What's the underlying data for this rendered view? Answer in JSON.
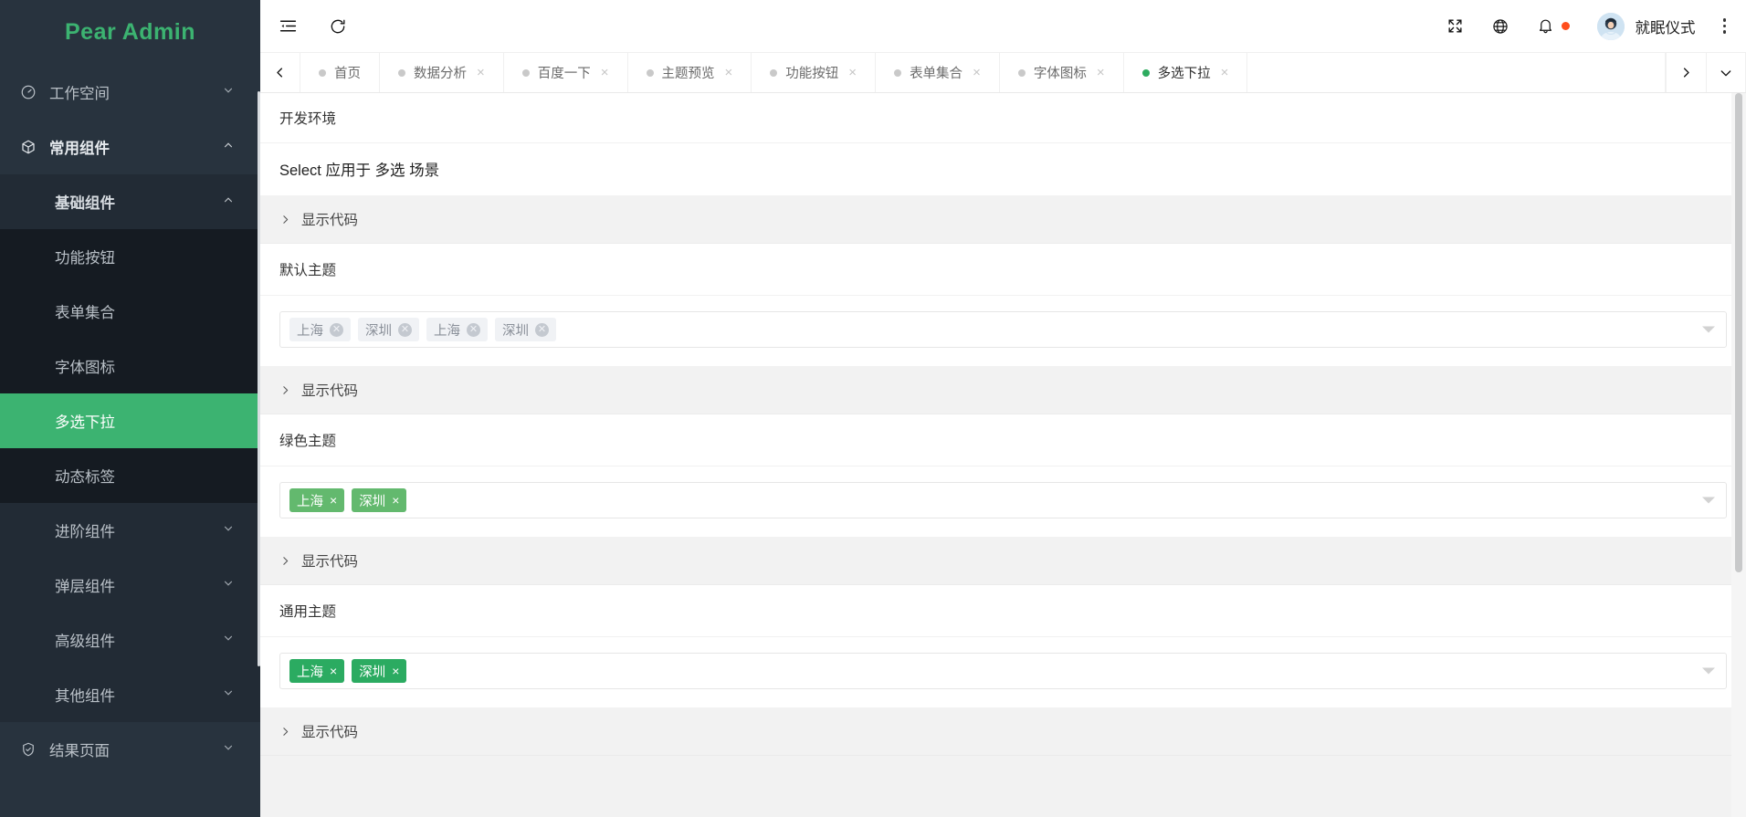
{
  "brand": {
    "title": "Pear Admin",
    "color": "#3cb371"
  },
  "sidebar": {
    "items": [
      {
        "label": "工作空间",
        "icon": "dashboard-icon",
        "caret": "chevron-down-icon"
      },
      {
        "label": "常用组件",
        "icon": "cube-icon",
        "caret": "chevron-up-icon"
      }
    ],
    "group": {
      "label": "基础组件",
      "caret": "chevron-up-icon",
      "children": [
        {
          "label": "功能按钮",
          "active": false
        },
        {
          "label": "表单集合",
          "active": false
        },
        {
          "label": "字体图标",
          "active": false
        },
        {
          "label": "多选下拉",
          "active": true
        },
        {
          "label": "动态标签",
          "active": false
        }
      ]
    },
    "collapsed_groups": [
      {
        "label": "进阶组件",
        "caret": "chevron-down-icon"
      },
      {
        "label": "弹层组件",
        "caret": "chevron-down-icon"
      },
      {
        "label": "高级组件",
        "caret": "chevron-down-icon"
      },
      {
        "label": "其他组件",
        "caret": "chevron-down-icon"
      }
    ],
    "footer": [
      {
        "label": "结果页面",
        "icon": "shield-check-icon",
        "caret": "chevron-down-icon"
      }
    ]
  },
  "topbar": {
    "collapse_icon": "menu-collapse-icon",
    "refresh_icon": "refresh-icon",
    "fullscreen_icon": "fullscreen-icon",
    "language_icon": "globe-icon",
    "notification_icon": "bell-icon",
    "notification_dot_color": "#ff4d1c",
    "user_name": "就眠仪式",
    "avatar_icon": "avatar",
    "more_icon": "kebab-menu-icon"
  },
  "tabbar": {
    "prev_icon": "chevron-left-icon",
    "next_icon": "chevron-right-icon",
    "dropdown_icon": "chevron-down-icon",
    "tabs": [
      {
        "label": "首页",
        "closable": false,
        "active": false
      },
      {
        "label": "数据分析",
        "closable": true,
        "active": false
      },
      {
        "label": "百度一下",
        "closable": true,
        "active": false
      },
      {
        "label": "主题预览",
        "closable": true,
        "active": false
      },
      {
        "label": "功能按钮",
        "closable": true,
        "active": false
      },
      {
        "label": "表单集合",
        "closable": true,
        "active": false
      },
      {
        "label": "字体图标",
        "closable": true,
        "active": false
      },
      {
        "label": "多选下拉",
        "closable": true,
        "active": true
      }
    ],
    "close_glyph": "×",
    "active_dot_color": "#2dab5f"
  },
  "content": {
    "env_card": {
      "header": "开发环境",
      "body": "Select 应用于 多选 场景"
    },
    "show_code_label": "显示代码",
    "sections": [
      {
        "title": "默认主题",
        "style": "plain",
        "tags": [
          {
            "label": "上海"
          },
          {
            "label": "深圳"
          },
          {
            "label": "上海"
          },
          {
            "label": "深圳"
          }
        ]
      },
      {
        "title": "绿色主题",
        "style": "green-soft",
        "tags": [
          {
            "label": "上海"
          },
          {
            "label": "深圳"
          }
        ]
      },
      {
        "title": "通用主题",
        "style": "green-solid",
        "tags": [
          {
            "label": "上海"
          },
          {
            "label": "深圳"
          }
        ]
      }
    ],
    "tag_close_glyph": "×",
    "tag_close_circle_glyph": "✕"
  }
}
